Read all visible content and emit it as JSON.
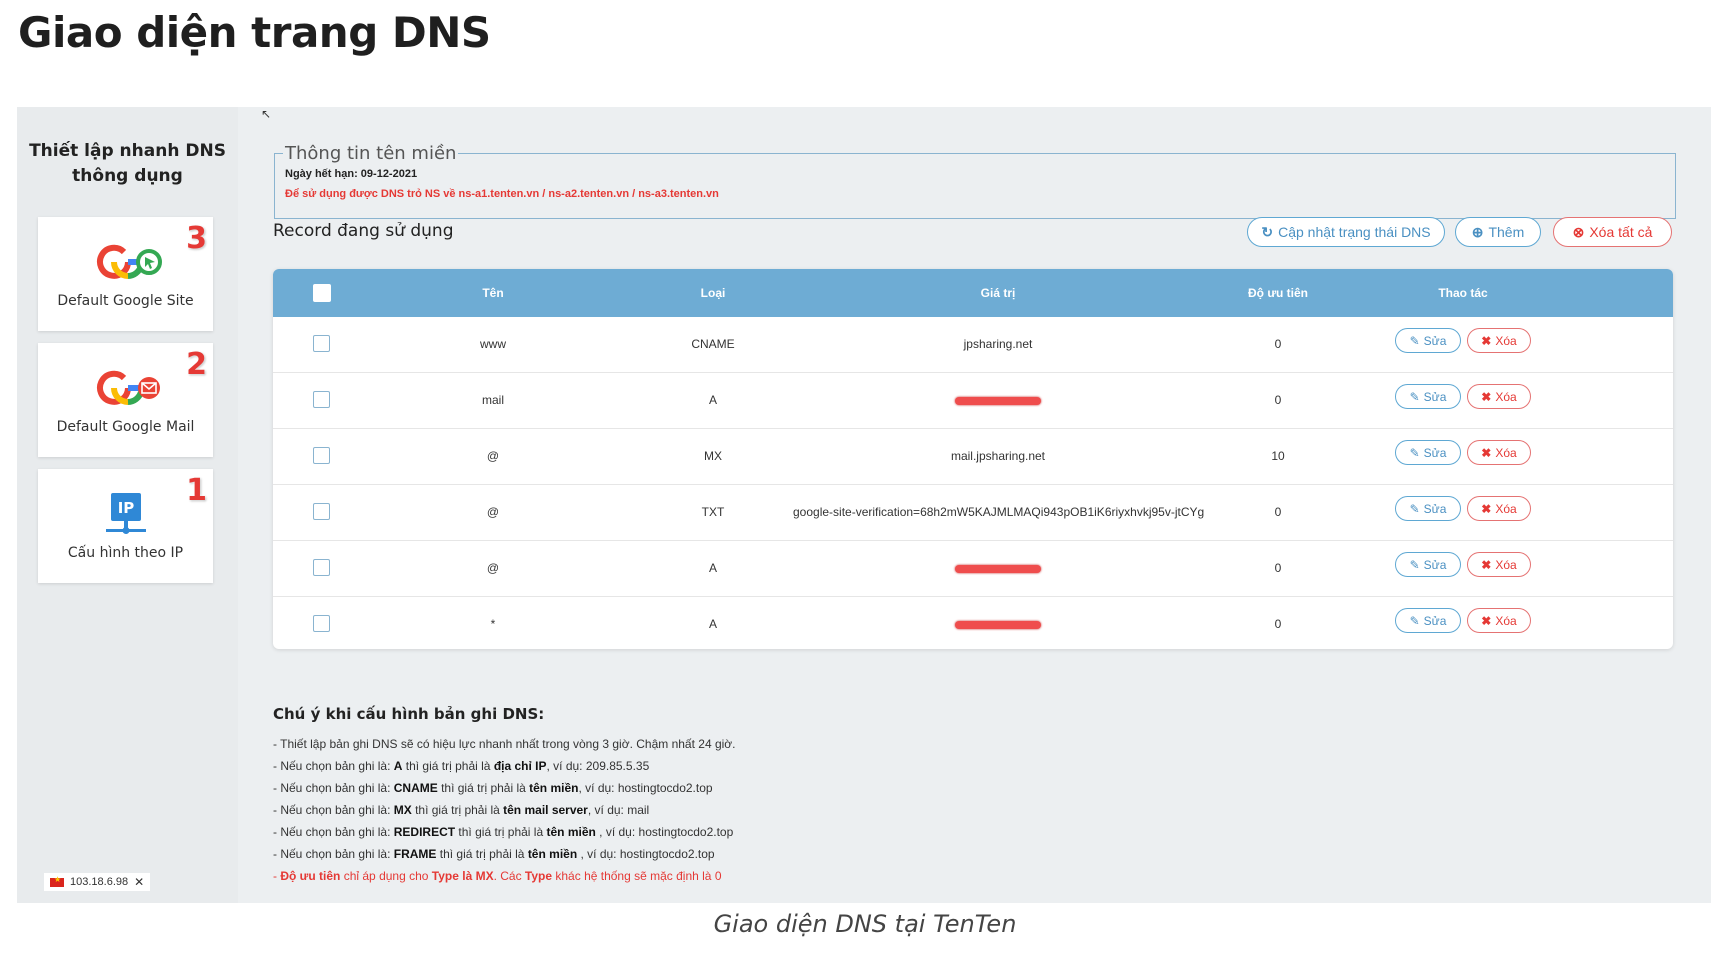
{
  "page": {
    "heading": "Giao diện trang DNS",
    "caption": "Giao diện DNS tại TenTen"
  },
  "sidebar": {
    "title_line1": "Thiết lập nhanh DNS",
    "title_line2": "thông dụng",
    "cards": [
      {
        "label": "Default Google Site",
        "number": "3",
        "icon": "google-site-icon"
      },
      {
        "label": "Default Google Mail",
        "number": "2",
        "icon": "google-mail-icon"
      },
      {
        "label": "Cấu hình theo IP",
        "number": "1",
        "icon": "ip-network-icon"
      }
    ],
    "ip_badge": {
      "ip": "103.18.6.98",
      "close": "✕"
    }
  },
  "domain_info": {
    "legend": "Thông tin tên miền",
    "expiry_label": "Ngày hết hạn:",
    "expiry_value": "09-12-2021",
    "ns_note": "Để sử dụng được DNS trỏ NS về ns-a1.tenten.vn / ns-a2.tenten.vn / ns-a3.tenten.vn"
  },
  "records": {
    "title": "Record đang sử dụng",
    "buttons": {
      "update": "Cập nhật trạng thái DNS",
      "add": "Thêm",
      "delete_all": "Xóa tất cả"
    },
    "columns": [
      "Tên",
      "Loại",
      "Giá trị",
      "Độ ưu tiên",
      "Thao tác"
    ],
    "edit_label": "Sửa",
    "delete_label": "Xóa",
    "rows": [
      {
        "name": "www",
        "type": "CNAME",
        "value": "jpsharing.net",
        "redacted": false,
        "priority": "0"
      },
      {
        "name": "mail",
        "type": "A",
        "value": "",
        "redacted": true,
        "priority": "0"
      },
      {
        "name": "@",
        "type": "MX",
        "value": "mail.jpsharing.net",
        "redacted": false,
        "priority": "10"
      },
      {
        "name": "@",
        "type": "TXT",
        "value": "google-site-verification=68h2mW5KAJMLMAQi943pOB1iK6riyxhvkj95v-jtCYg",
        "redacted": false,
        "priority": "0"
      },
      {
        "name": "@",
        "type": "A",
        "value": "",
        "redacted": true,
        "priority": "0"
      },
      {
        "name": "*",
        "type": "A",
        "value": "",
        "redacted": true,
        "priority": "0"
      }
    ]
  },
  "notes": {
    "title": "Chú ý khi cấu hình bản ghi DNS:",
    "line1": "- Thiết lập bản ghi DNS sẽ có hiệu lực nhanh nhất trong vòng 3 giờ. Chậm nhất 24 giờ.",
    "a_pre": "- Nếu chọn bản ghi là: ",
    "a_type": "A",
    "a_mid": " thì giá trị phải là ",
    "a_kind": "địa chỉ IP",
    "a_post": ", ví dụ: 209.85.5.35",
    "cname_pre": "- Nếu chọn bản ghi là: ",
    "cname_type": "CNAME",
    "cname_mid": " thì giá trị phải là ",
    "cname_kind": "tên miền",
    "cname_post": ", ví dụ: hostingtocdo2.top",
    "mx_pre": "- Nếu chọn bản ghi là: ",
    "mx_type": "MX",
    "mx_mid": " thì giá trị phải là ",
    "mx_kind": "tên mail server",
    "mx_post": ", ví dụ: mail",
    "redirect_pre": "- Nếu chọn bản ghi là: ",
    "redirect_type": "REDIRECT",
    "redirect_mid": " thì giá trị phải là ",
    "redirect_kind": "tên miền",
    "redirect_post": " , ví dụ: hostingtocdo2.top",
    "frame_pre": "- Nếu chọn bản ghi là: ",
    "frame_type": "FRAME",
    "frame_mid": " thì giá trị phải là ",
    "frame_kind": "tên miền",
    "frame_post": " , ví dụ: hostingtocdo2.top",
    "prio_pre": "- ",
    "prio_b1": "Độ ưu tiên",
    "prio_mid1": " chỉ áp dụng cho ",
    "prio_b2": "Type là MX",
    "prio_mid2": ". Các ",
    "prio_b3": "Type",
    "prio_post": " khác hệ thống sẽ mặc định là 0"
  },
  "colors": {
    "header_blue": "#6eacd4",
    "accent_blue": "#4a90c2",
    "danger_red": "#e53935"
  }
}
